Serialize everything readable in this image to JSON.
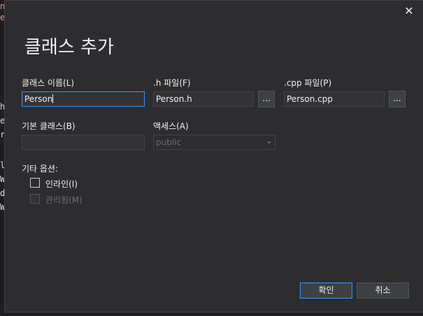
{
  "background_glyphs": [
    "n",
    "e",
    "h",
    "e",
    "re",
    "la",
    "W",
    "d",
    "W"
  ],
  "dialog": {
    "title": "클래스 추가",
    "close_glyph": "✕",
    "class_name": {
      "label": "클래스 이름(L)",
      "value": "Person"
    },
    "h_file": {
      "label": ".h 파일(F)",
      "value": "Person.h",
      "browse": "..."
    },
    "cpp_file": {
      "label": ".cpp 파일(P)",
      "value": "Person.cpp",
      "browse": "..."
    },
    "base_class": {
      "label": "기본 클래스(B)",
      "value": ""
    },
    "access": {
      "label": "액세스(A)",
      "value": "public"
    },
    "other_options": {
      "label": "기타 옵션:"
    },
    "inline": {
      "label": "인라인(I)",
      "checked": false
    },
    "managed": {
      "label": "관리됨(M)",
      "checked": false,
      "disabled": true
    },
    "ok_button": "확인",
    "cancel_button": "취소"
  },
  "colors": {
    "accent": "#3399ff",
    "dialog_bg": "#2d2d30",
    "input_bg": "#333337"
  }
}
